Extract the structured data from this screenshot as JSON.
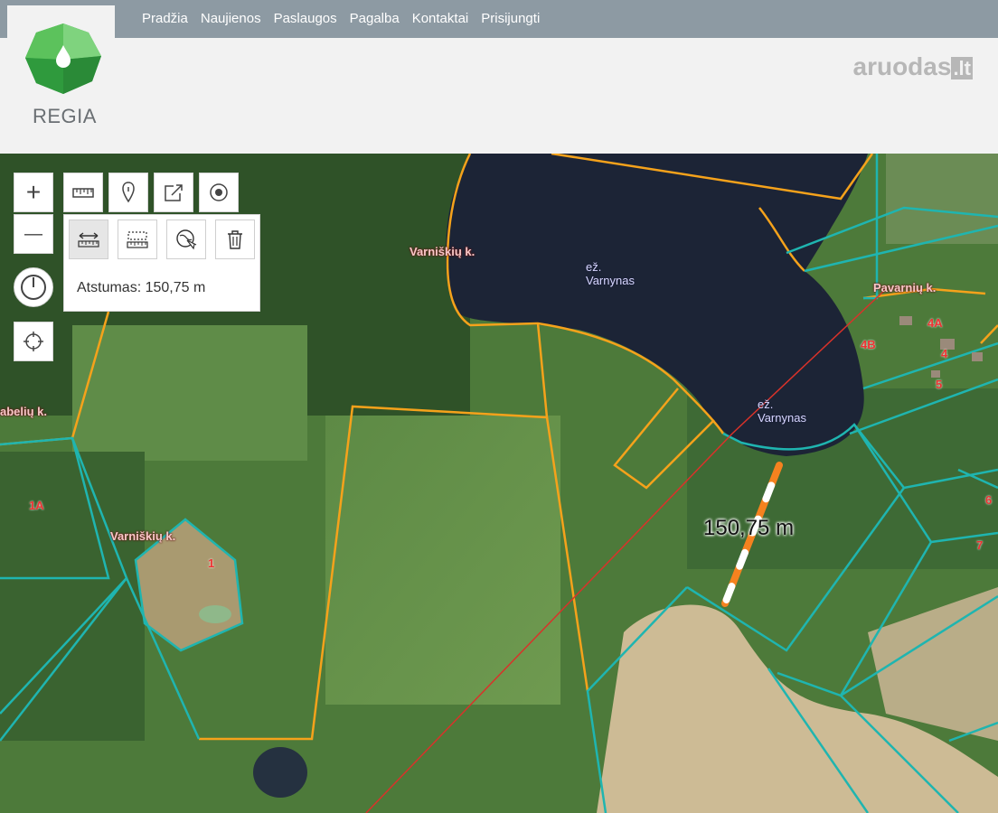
{
  "nav": {
    "items": [
      "Pradžia",
      "Naujienos",
      "Paslaugos",
      "Pagalba",
      "Kontaktai",
      "Prisijungti"
    ]
  },
  "brand": {
    "name": "REGIA"
  },
  "watermark": {
    "text": "aruodas",
    "suffix": ".lt"
  },
  "controls": {
    "zoom_in": "+",
    "zoom_out": "—"
  },
  "measure": {
    "distance_text": "Atstumas: 150,75 m",
    "map_label": "150,75 m"
  },
  "map_labels": {
    "village_1": "Varniškių k.",
    "village_2": "abelių k.",
    "village_3": "Varniškių k.",
    "village_4": "Pavarnių k.",
    "lake_1a": "ež.",
    "lake_1b": "Varnynas",
    "lake_2a": "ež.",
    "lake_2b": "Varnynas"
  },
  "parcels": [
    "1A",
    "1",
    "4A",
    "4B",
    "4",
    "5",
    "6",
    "7"
  ],
  "colors": {
    "topnav": "#8d9aa3",
    "header": "#f2f2f2",
    "parcel_orange": "#f5a21b",
    "parcel_teal": "#1fb5b0",
    "power_line": "#d9322a",
    "lake": "#1c2436",
    "brand_green": "#3cb04a"
  },
  "icons": [
    "plus-icon",
    "minus-icon",
    "compass-icon",
    "locate-icon",
    "ruler-icon",
    "pin-icon",
    "share-icon",
    "target-icon",
    "distance-icon",
    "area-icon",
    "clear-measure-icon",
    "trash-icon"
  ]
}
